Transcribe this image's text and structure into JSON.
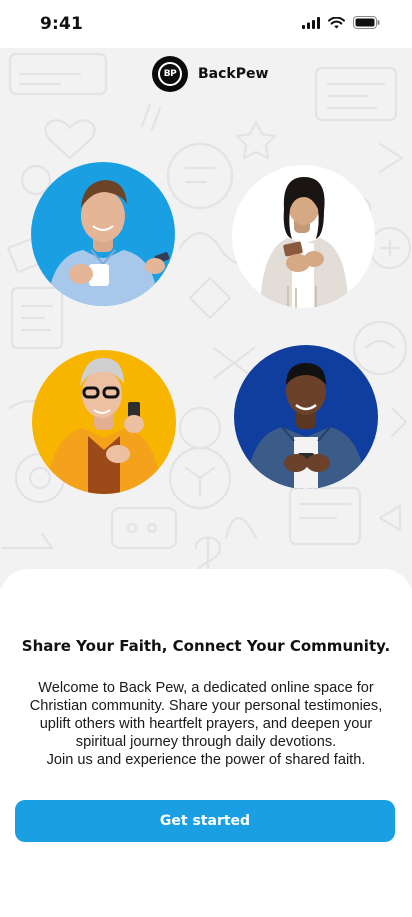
{
  "status_bar": {
    "time": "9:41"
  },
  "brand": {
    "logo_text": "BP",
    "name": "BackPew"
  },
  "people": [
    {
      "name": "man-with-coffee-photo",
      "bg": "#1a9fe3"
    },
    {
      "name": "woman-with-phone-photo",
      "bg": "#ffffff"
    },
    {
      "name": "older-man-with-phone-photo",
      "bg": "#f7b500"
    },
    {
      "name": "man-in-denim-photo",
      "bg": "#0f3e9f"
    }
  ],
  "content": {
    "headline": "Share Your Faith, Connect Your Community.",
    "paragraph_lines": [
      "Welcome to Back Pew, a dedicated online space for",
      "Christian community. Share your personal testimonies,",
      "uplift others with heartfelt prayers, and deepen your",
      "spiritual journey through daily devotions.",
      "Join us and experience the power of shared faith."
    ]
  },
  "cta": {
    "label": "Get started"
  },
  "colors": {
    "accent": "#1a9fe3",
    "hero_bg": "#f2f2f3"
  }
}
